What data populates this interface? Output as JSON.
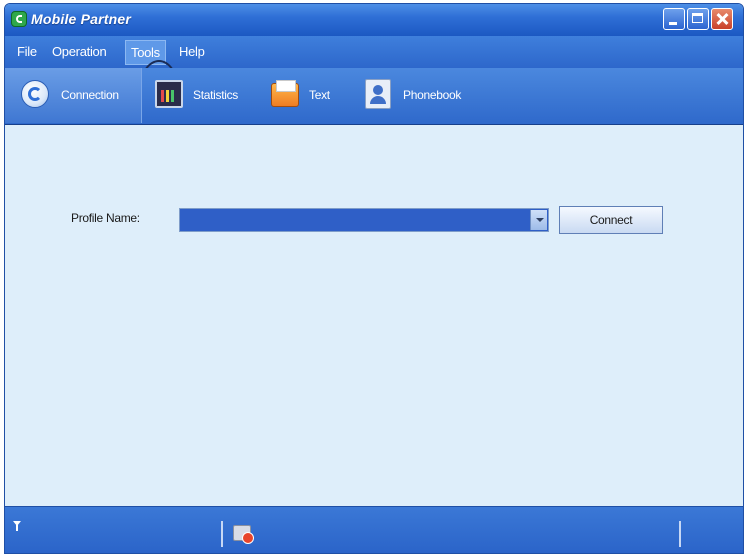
{
  "window": {
    "title": "Mobile Partner"
  },
  "menu": {
    "items": [
      "File",
      "Operation",
      "Tools",
      "Help"
    ]
  },
  "toolbar": {
    "tabs": [
      {
        "label": "Connection",
        "icon": "connection-icon",
        "active": true
      },
      {
        "label": "Statistics",
        "icon": "statistics-icon",
        "active": false
      },
      {
        "label": "Text",
        "icon": "text-message-icon",
        "active": false
      },
      {
        "label": "Phonebook",
        "icon": "phonebook-icon",
        "active": false
      }
    ]
  },
  "connection": {
    "profile_label": "Profile Name:",
    "profile_value": "",
    "connect_label": "Connect"
  },
  "colors": {
    "title_bar": "#2f6fd6",
    "toolbar": "#3f77d2",
    "content_bg": "#deeefa",
    "profile_select": "#2f5fc7"
  }
}
